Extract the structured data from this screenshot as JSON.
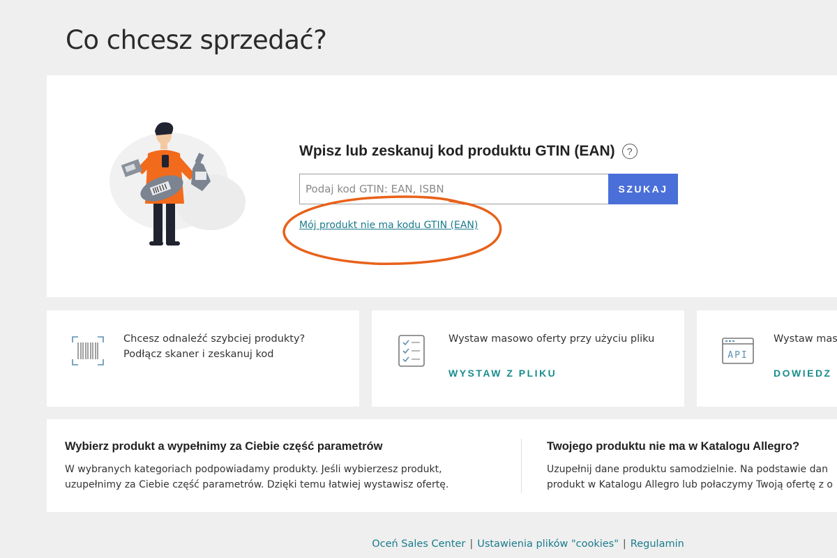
{
  "page": {
    "title": "Co chcesz sprzedać?"
  },
  "search": {
    "heading": "Wpisz lub zeskanuj kod produktu GTIN (EAN)",
    "help_icon": "?",
    "placeholder": "Podaj kod GTIN: EAN, ISBN",
    "value": "",
    "button_label": "SZUKAJ",
    "no_code_link": "Mój produkt nie ma kodu GTIN (EAN)"
  },
  "features": [
    {
      "icon": "barcode-scanner-icon",
      "lines": [
        "Chcesz odnaleźć szybciej produkty?",
        "Podłącz skaner i zeskanuj kod"
      ],
      "link": ""
    },
    {
      "icon": "checklist-file-icon",
      "lines": [
        "Wystaw masowo oferty przy użyciu pliku"
      ],
      "link": "WYSTAW Z PLIKU"
    },
    {
      "icon": "api-icon",
      "icon_text": "API",
      "lines": [
        "Wystaw mas"
      ],
      "link": "DOWIEDZ"
    }
  ],
  "info": {
    "left": {
      "title": "Wybierz produkt a wypełnimy za Ciebie część parametrów",
      "lines": [
        "W wybranych kategoriach podpowiadamy produkty. Jeśli wybierzesz produkt,",
        "uzupełnimy za Ciebie część parametrów. Dzięki temu łatwiej wystawisz ofertę."
      ]
    },
    "right": {
      "title": "Twojego produktu nie ma w Katalogu Allegro?",
      "lines": [
        "Uzupełnij dane produktu samodzielnie. Na podstawie dan",
        "produkt w Katalogu Allegro lub połaczymy Twoją ofertę z o"
      ]
    }
  },
  "footer": {
    "links": [
      "Oceń Sales Center",
      "Ustawienia plików \"cookies\"",
      "Regulamin"
    ],
    "separator": "|"
  },
  "colors": {
    "accent": "#4a6fd8",
    "link": "#1a7b8c",
    "highlight": "#e8611a",
    "person_shirt": "#f26a1b"
  }
}
